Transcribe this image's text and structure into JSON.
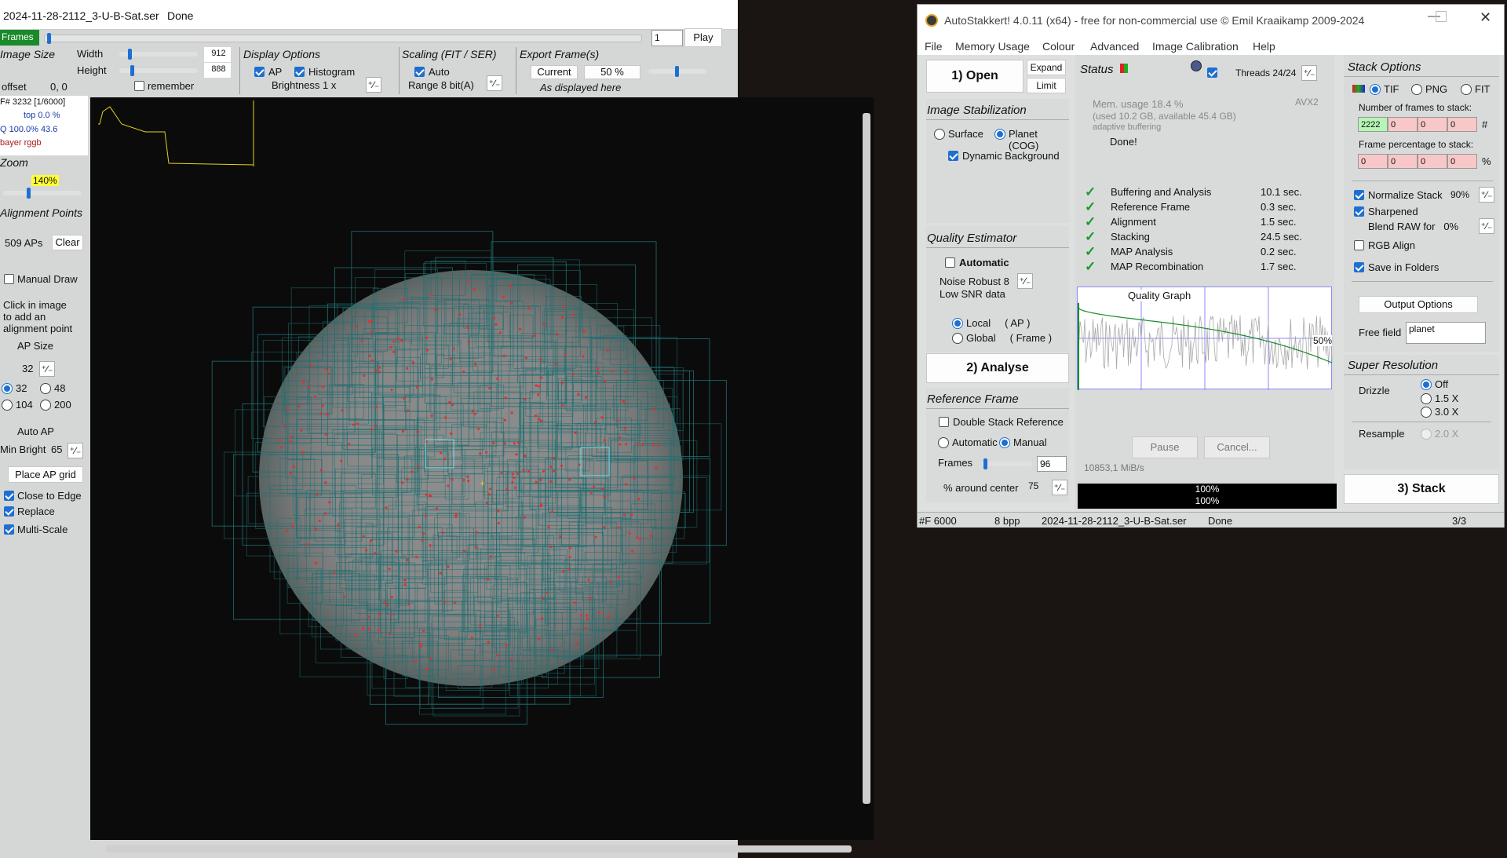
{
  "left": {
    "title": "2024-11-28-2112_3-U-B-Sat.ser",
    "status": "Done",
    "frames_label": "Frames",
    "frame_input": "1",
    "play": "Play",
    "image_size": "Image Size",
    "width_label": "Width",
    "width_val": "912",
    "height_label": "Height",
    "height_val": "888",
    "offset_label": "offset",
    "offset_val": "0, 0",
    "remember": "remember",
    "display_options": "Display Options",
    "ap_label": "AP",
    "histogram_label": "Histogram",
    "brightness": "Brightness  1 x",
    "scaling": "Scaling (FIT / SER)",
    "auto": "Auto",
    "range": "Range 8 bit(A)",
    "export": "Export Frame(s)",
    "current": "Current",
    "export_pct": "50 %",
    "as_displayed": "As displayed here",
    "frame_info": "F# 3232 [1/6000]",
    "top_info": "top 0.0 %",
    "q_info": "Q 100.0%  43.6",
    "bayer": "bayer rggb",
    "zoom_label": "Zoom",
    "zoom_val": "140%",
    "ap_header": "Alignment Points",
    "aps": "509 APs",
    "clear": "Clear",
    "manual_draw": "Manual Draw",
    "click_info": "Click in image\nto add an\nalignment point",
    "ap_size": "AP Size",
    "ap_size_val": "32",
    "sizes": [
      "32",
      "48",
      "104",
      "200"
    ],
    "auto_ap": "Auto AP",
    "min_bright": "Min Bright",
    "min_bright_val": "65",
    "place_grid": "Place AP grid",
    "close_edge": "Close to Edge",
    "replace": "Replace",
    "multi_scale": "Multi-Scale"
  },
  "right": {
    "title": "AutoStakkert! 4.0.11 (x64) - free for non-commercial use © Emil Kraaikamp 2009-2024",
    "menu": [
      "File",
      "Memory Usage",
      "Colour",
      "Advanced",
      "Image Calibration",
      "Help"
    ],
    "open": "1) Open",
    "expand": "Expand",
    "limit": "Limit",
    "status": "Status",
    "threads": "Threads 24/24",
    "avx": "AVX2",
    "mem1": "Mem. usage 18.4 %",
    "mem2": "(used 10.2 GB, available 45.4 GB)",
    "mem3": "adaptive buffering",
    "done": "Done!",
    "steps": [
      {
        "name": "Buffering and Analysis",
        "time": "10.1 sec."
      },
      {
        "name": "Reference Frame",
        "time": "0.3 sec."
      },
      {
        "name": "Alignment",
        "time": "1.5 sec."
      },
      {
        "name": "Stacking",
        "time": "24.5 sec."
      },
      {
        "name": "MAP Analysis",
        "time": "0.2 sec."
      },
      {
        "name": "MAP Recombination",
        "time": "1.7 sec."
      }
    ],
    "quality_graph": "Quality Graph",
    "graph_pct": "50%",
    "pause": "Pause",
    "cancel": "Cancel...",
    "speed": "10853,1 MiB/s",
    "prog1": "100%",
    "prog2": "100%",
    "image_stab": "Image Stabilization",
    "surface": "Surface",
    "planet": "Planet (COG)",
    "dyn_bg": "Dynamic Background",
    "quality_est": "Quality Estimator",
    "automatic": "Automatic",
    "noise": "Noise Robust  8",
    "low_snr": "Low SNR data",
    "local": "Local     ( AP )",
    "global": "Global     ( Frame )",
    "analyse": "2) Analyse",
    "ref_frame": "Reference Frame",
    "double_stack": "Double Stack Reference",
    "ref_auto": "Automatic",
    "ref_manual": "Manual",
    "frames": "Frames",
    "frames_val": "96",
    "around": "% around center",
    "around_val": "75",
    "stack_opts": "Stack Options",
    "tif": "TIF",
    "png": "PNG",
    "fit": "FIT",
    "num_frames": "Number of frames to stack:",
    "nf": [
      "2222",
      "0",
      "0",
      "0"
    ],
    "frame_pct": "Frame percentage to stack:",
    "fp": [
      "0",
      "0",
      "0",
      "0"
    ],
    "hash": "#",
    "pct": "%",
    "normalize": "Normalize Stack",
    "normalize_val": "90%",
    "sharpened": "Sharpened",
    "blend": "Blend RAW for   0%",
    "rgb_align": "RGB Align",
    "save_folders": "Save in Folders",
    "output_opts": "Output Options",
    "free_field": "Free field",
    "free_val": "planet",
    "super_res": "Super Resolution",
    "drizzle": "Drizzle",
    "off": "Off",
    "x15": "1.5 X",
    "x30": "3.0 X",
    "resample": "Resample",
    "x20": "2.0 X",
    "stack": "3) Stack",
    "sb_frames": "#F 6000",
    "sb_bpp": "8 bpp",
    "sb_file": "2024-11-28-2112_3-U-B-Sat.ser",
    "sb_done": "Done",
    "sb_page": "3/3"
  }
}
